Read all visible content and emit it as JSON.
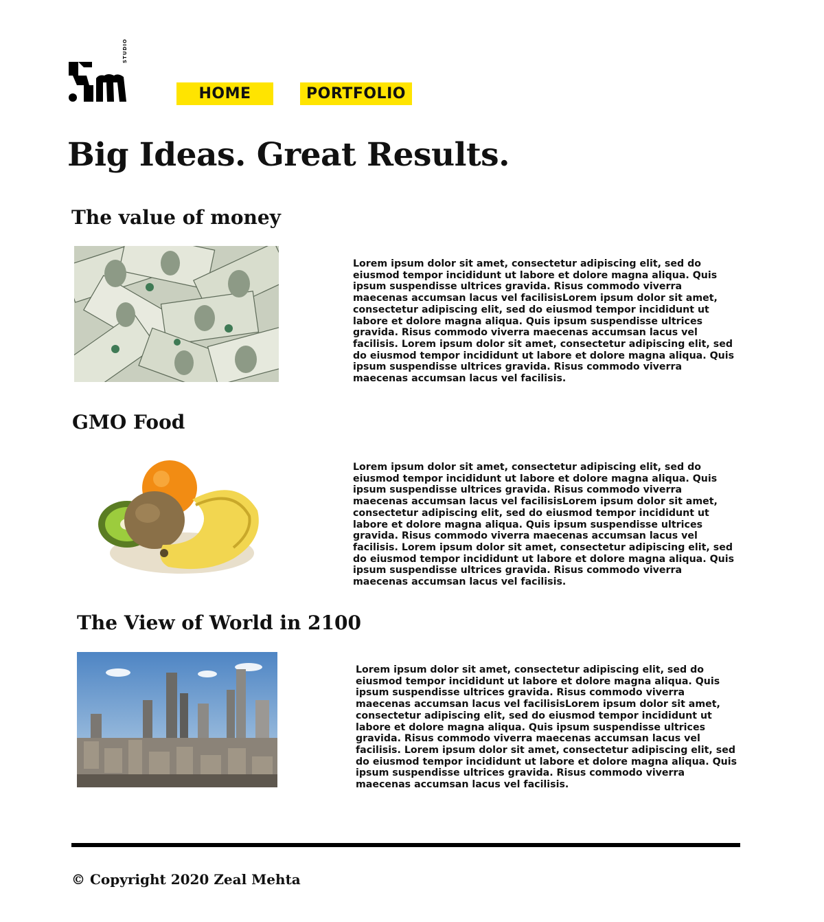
{
  "logo": {
    "text": "Sm",
    "studio_label": "STUDIO"
  },
  "nav": {
    "home": "HOME",
    "portfolio": "PORTFOLIO"
  },
  "hero": {
    "title": "Big Ideas. Great Results."
  },
  "sections": [
    {
      "title": "The value of money",
      "image": "money-photo",
      "body": "Lorem ipsum dolor sit amet, consectetur adipiscing elit, sed do eiusmod tempor incididunt ut labore et dolore magna aliqua. Quis ipsum suspendisse ultrices gravida. Risus commodo viverra maecenas accumsan lacus vel facilisisLorem ipsum dolor sit amet, consectetur adipiscing elit, sed do eiusmod tempor incididunt ut labore et dolore magna aliqua. Quis ipsum suspendisse ultrices gravida. Risus commodo viverra maecenas accumsan lacus vel facilisis. Lorem ipsum dolor sit amet, consectetur adipiscing elit, sed do eiusmod tempor incididunt ut labore et dolore magna aliqua. Quis ipsum suspendisse ultrices gravida. Risus commodo viverra maecenas accumsan lacus vel facilisis."
    },
    {
      "title": "GMO Food",
      "image": "fruit-photo",
      "body": "Lorem ipsum dolor sit amet, consectetur adipiscing elit, sed do eiusmod tempor incididunt ut labore et dolore magna aliqua. Quis ipsum suspendisse ultrices gravida. Risus commodo viverra maecenas accumsan lacus vel facilisisLorem ipsum dolor sit amet, consectetur adipiscing elit, sed do eiusmod tempor incididunt ut labore et dolore magna aliqua. Quis ipsum suspendisse ultrices gravida. Risus commodo viverra maecenas accumsan lacus vel facilisis. Lorem ipsum dolor sit amet, consectetur adipiscing elit, sed do eiusmod tempor incididunt ut labore et dolore magna aliqua. Quis ipsum suspendisse ultrices gravida. Risus commodo viverra maecenas accumsan lacus vel facilisis."
    },
    {
      "title": "The View of World in 2100",
      "image": "city-photo",
      "body": "Lorem ipsum dolor sit amet, consectetur adipiscing elit, sed do eiusmod tempor incididunt ut labore et dolore magna aliqua. Quis ipsum suspendisse ultrices gravida. Risus commodo viverra maecenas accumsan lacus vel facilisisLorem ipsum dolor sit amet, consectetur adipiscing elit, sed do eiusmod tempor incididunt ut labore et dolore magna aliqua. Quis ipsum suspendisse ultrices gravida. Risus commodo viverra maecenas accumsan lacus vel facilisis. Lorem ipsum dolor sit amet, consectetur adipiscing elit, sed do eiusmod tempor incididunt ut labore et dolore magna aliqua. Quis ipsum suspendisse ultrices gravida. Risus commodo viverra maecenas accumsan lacus vel facilisis."
    }
  ],
  "footer": {
    "copyright": "© Copyright 2020 Zeal Mehta"
  },
  "colors": {
    "accent": "#ffe400",
    "text": "#111111",
    "rule": "#000000"
  }
}
